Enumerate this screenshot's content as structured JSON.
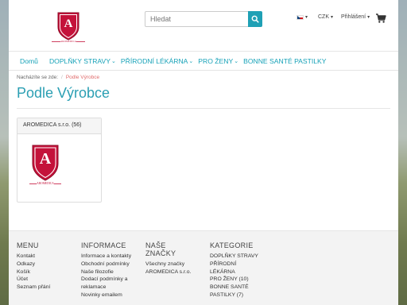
{
  "brand": {
    "logo_letter": "A",
    "logo_text": "AROMEDICA"
  },
  "search": {
    "placeholder": "Hledat"
  },
  "header": {
    "currency": "CZK",
    "login": "Přihlášení"
  },
  "nav": [
    {
      "label": "Domů",
      "dropdown": false
    },
    {
      "label": "DOPLŇKY STRAVY",
      "dropdown": true
    },
    {
      "label": "PŘÍRODNÍ LÉKÁRNA",
      "dropdown": true
    },
    {
      "label": "PRO ŽENY",
      "dropdown": true
    },
    {
      "label": "BONNE SANTÉ PASTILKY",
      "dropdown": false
    }
  ],
  "breadcrumb": {
    "prefix": "Nacházíte se zde:",
    "sep": "/",
    "current": "Podle Výrobce"
  },
  "page_title": "Podle Výrobce",
  "manufacturer": {
    "name": "AROMEDICA s.r.o. (56)"
  },
  "footer": {
    "menu": {
      "title": "MENU",
      "items": [
        "Kontakt",
        "Odkazy",
        "Košík",
        "Účet",
        "Seznam přání"
      ]
    },
    "info": {
      "title": "INFORMACE",
      "items": [
        "Informace a kontakty",
        "Obchodní podmínky",
        "Naše filozofie",
        "Dodací podmínky a reklamace",
        "Novinky emailem"
      ]
    },
    "brands": {
      "title": "NAŠE ZNAČKY",
      "items": [
        "Všechny značky",
        "AROMEDICA s.r.o."
      ]
    },
    "categories": {
      "title": "KATEGORIE",
      "items": [
        "DOPLŇKY STRAVY",
        "PŘÍRODNÍ LÉKÁRNA",
        "PRO ŽENY (10)",
        "BONNE SANTÉ PASTILKY (7)"
      ]
    }
  },
  "colors": {
    "accent": "#17a2b8",
    "logo_red": "#c4123a",
    "breadcrumb_current": "#e06b6b"
  }
}
